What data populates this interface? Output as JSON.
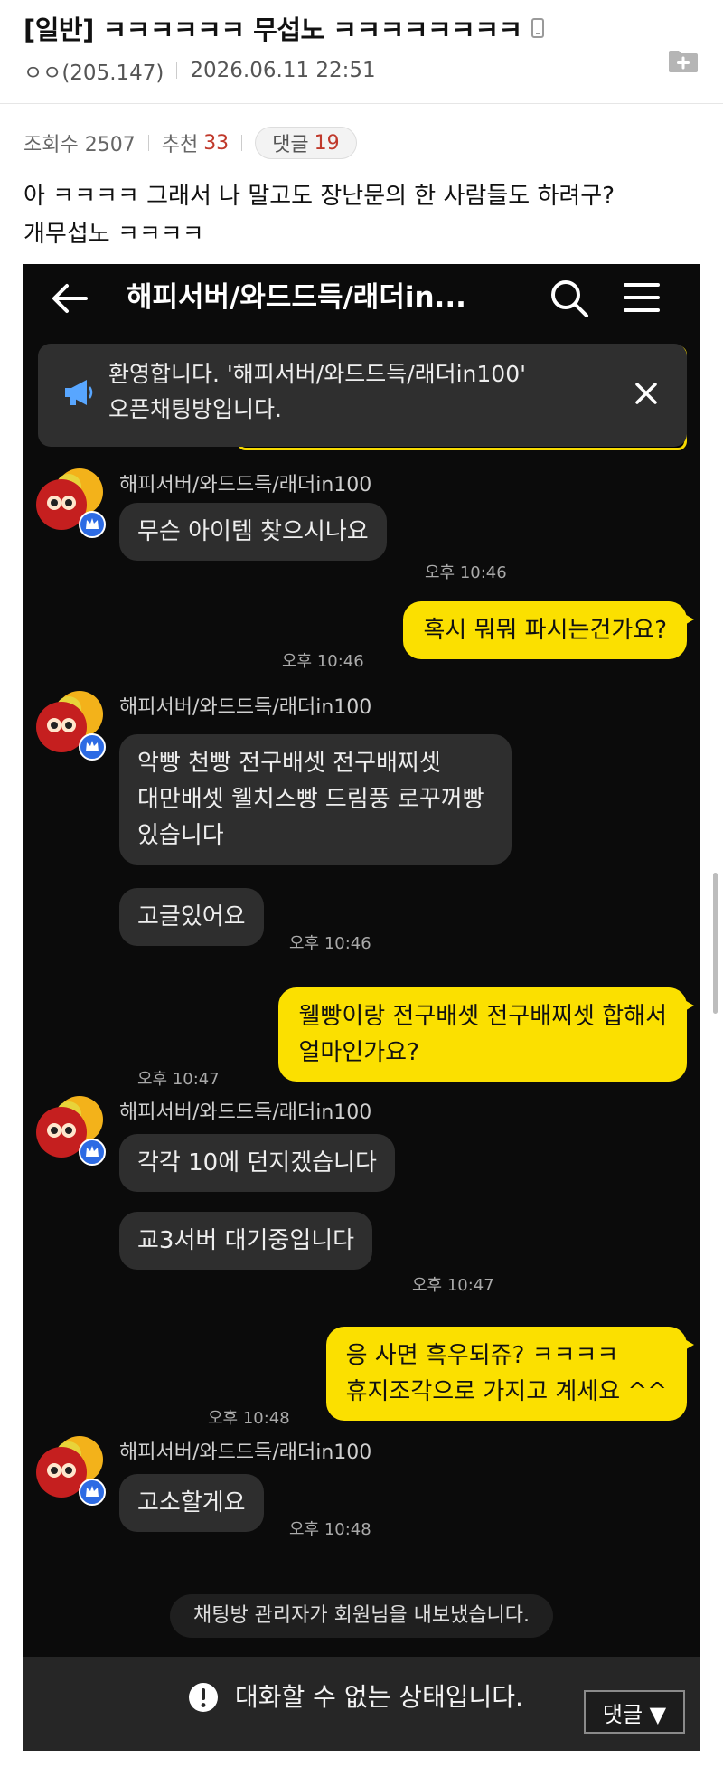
{
  "post": {
    "title": "[일반] ㅋㅋㅋㅋㅋㅋ 무섭노 ㅋㅋㅋㅋㅋㅋㅋㅋ",
    "author": "ㅇㅇ(205.147)",
    "datetime": "2026.06.11 22:51",
    "views_label": "조회수 2507",
    "recommend_label": "추천",
    "recommend_count": "33",
    "comment_label": "댓글",
    "comment_count": "19",
    "body_lines": [
      "아 ㅋㅋㅋㅋ 그래서 나 말고도 장난문의 한 사람들도 하려구?",
      "개무섭노 ㅋㅋㅋㅋ"
    ]
  },
  "chat": {
    "room_title": "해피서버/와드드득/래더in...",
    "notice_lines": [
      "환영합니다. '해피서버/와드드득/래더in100'",
      "오픈채팅방입니다."
    ],
    "sender_name": "해피서버/와드드득/래더in100",
    "messages": [
      {
        "text": "무슨 아이템 찾으시나요",
        "time": "오후 10:46"
      },
      {
        "text": "혹시 뭐뭐 파시는건가요?",
        "time": "오후 10:46"
      },
      {
        "lines": [
          "악빵 천빵 전구배셋 전구배찌셋",
          "대만배셋 웰치스빵 드림풍 로꾸꺼빵",
          "있습니다"
        ]
      },
      {
        "text": "고글있어요",
        "time": "오후 10:46"
      },
      {
        "lines": [
          "웰빵이랑 전구배셋 전구배찌셋 합해서",
          "얼마인가요?"
        ],
        "time": "오후 10:47"
      },
      {
        "text": "각각 10에 던지겠습니다"
      },
      {
        "text": "교3서버 대기중입니다",
        "time": "오후 10:47"
      },
      {
        "lines": [
          "응 사면 흑우되쥬? ㅋㅋㅋㅋ",
          "휴지조각으로 가지고 계세요 ^^"
        ],
        "time": "오후 10:48"
      },
      {
        "text": "고소할게요",
        "time": "오후 10:48"
      }
    ],
    "system_message": "채팅방 관리자가 회원님을 내보냈습니다.",
    "input_disabled_text": "대화할 수 없는 상태입니다.",
    "comment_button_label": "댓글 ▼"
  },
  "colors": {
    "chat_background": "#0b0b0b",
    "my_bubble": "#fbe000",
    "other_bubble": "#2e2e2e",
    "count_red": "#c0392b"
  },
  "icons": [
    "mobile-icon",
    "folder-add-icon",
    "back-arrow-icon",
    "search-icon",
    "menu-icon",
    "megaphone-icon",
    "close-icon",
    "avatar",
    "alert-icon"
  ]
}
